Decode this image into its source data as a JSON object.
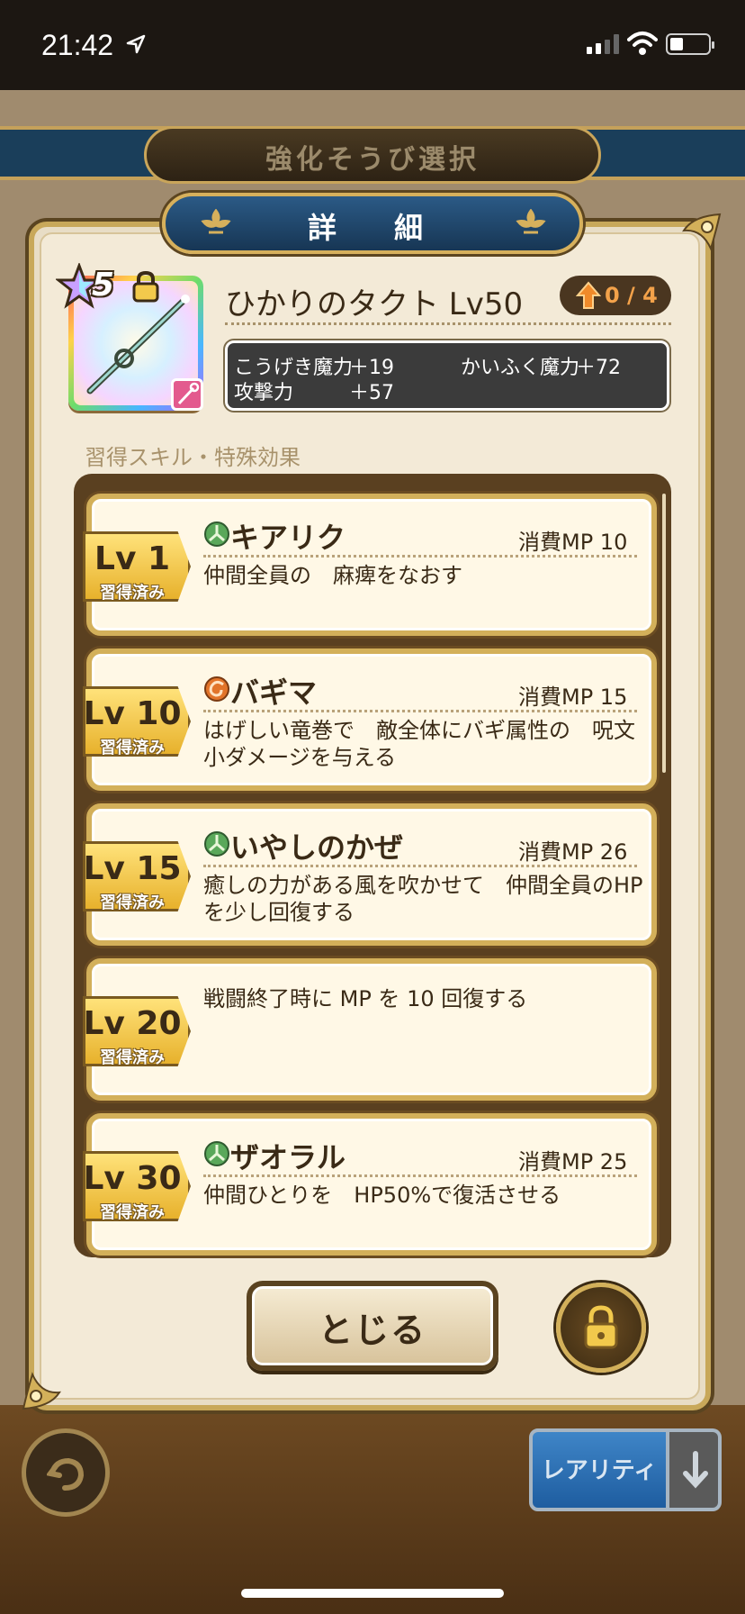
{
  "status_bar": {
    "time": "21:42"
  },
  "background": {
    "title": "強化そうび選択",
    "rarity_button": "レアリティ"
  },
  "dialog": {
    "title": "詳　細",
    "item": {
      "stars": "5",
      "name": "ひかりのタクト Lv50",
      "upgrade": "0 / 4",
      "stats": [
        {
          "label": "こうげき魔力",
          "value": "＋19"
        },
        {
          "label": "かいふく魔力",
          "value": "＋72"
        },
        {
          "label": "攻撃力",
          "value": "＋57"
        }
      ]
    },
    "section_label": "習得スキル・特殊効果",
    "skills": [
      {
        "level": "Lv 1",
        "learned": "習得済み",
        "name": "キアリク",
        "mp": "消費MP 10",
        "desc": "仲間全員の　麻痺をなおす",
        "icon": "green-heal-icon"
      },
      {
        "level": "Lv 10",
        "learned": "習得済み",
        "name": "バギマ",
        "mp": "消費MP 15",
        "desc": "はげしい竜巻で　敵全体にバギ属性の　呪文小ダメージを与える",
        "icon": "wind-spell-icon"
      },
      {
        "level": "Lv 15",
        "learned": "習得済み",
        "name": "いやしのかぜ",
        "mp": "消費MP 26",
        "desc": "癒しの力がある風を吹かせて　仲間全員のHPを少し回復する",
        "icon": "green-heal-icon"
      },
      {
        "level": "Lv 20",
        "learned": "習得済み",
        "name": "",
        "mp": "",
        "desc": "戦闘終了時に MP を 10 回復する",
        "icon": ""
      },
      {
        "level": "Lv 30",
        "learned": "習得済み",
        "name": "ザオラル",
        "mp": "消費MP 25",
        "desc": "仲間ひとりを　HP50%で復活させる",
        "icon": "green-heal-icon"
      }
    ],
    "close_label": "とじる"
  },
  "colors": {
    "panel_bg": "#f3ead7",
    "gold_border": "#d3b05a",
    "header_blue": "#1f4a72",
    "list_bg": "#5a4020"
  }
}
